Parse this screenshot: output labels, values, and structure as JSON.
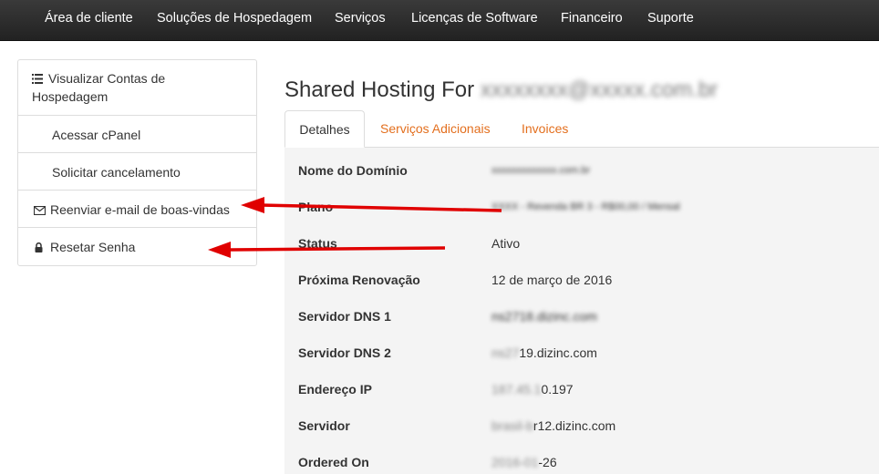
{
  "topnav": {
    "items": [
      "Área de cliente",
      "Soluções de Hospedagem",
      "Serviços",
      "Licenças de Software",
      "Financeiro",
      "Suporte"
    ]
  },
  "sidebar": {
    "header": "Visualizar Contas de Hospedagem",
    "items": [
      {
        "label": "Acessar cPanel",
        "icon": ""
      },
      {
        "label": "Solicitar cancelamento",
        "icon": ""
      },
      {
        "label": "Reenviar e-mail de boas-vindas",
        "icon": "envelope-icon"
      },
      {
        "label": "Resetar Senha",
        "icon": "lock-icon"
      }
    ]
  },
  "page": {
    "title": "Shared Hosting For",
    "title_redacted": "xxxxxxxx@xxxxx.com.br"
  },
  "tabs": [
    "Detalhes",
    "Serviços Adicionais",
    "Invoices"
  ],
  "details": {
    "rows": [
      {
        "label": "Nome do Domínio",
        "value": "xxxxxxxxxxxxx.com.br"
      },
      {
        "label": "Plano",
        "value": "XXXX - Revenda BR 3 - R$00,00 / Mensal"
      },
      {
        "label": "Status",
        "value": "Ativo"
      },
      {
        "label": "Próxima Renovação",
        "value": "12 de março de 2016"
      },
      {
        "label": "Servidor DNS 1",
        "value": "ns2718.dizinc.com"
      },
      {
        "label": "Servidor DNS 2",
        "value_hidden": "ns27",
        "value": "19.dizinc.com"
      },
      {
        "label": "Endereço IP",
        "value_hidden": "187.45.1",
        "value": "0.197"
      },
      {
        "label": "Servidor",
        "value_hidden": "brasil-b",
        "value": "r12.dizinc.com"
      },
      {
        "label": "Ordered On",
        "value_hidden": "2016-01",
        "value": "-26"
      }
    ]
  },
  "colors": {
    "accent": "#e36f1e",
    "nav_bg": "#2b2b2b",
    "arrow": "#e00000"
  }
}
